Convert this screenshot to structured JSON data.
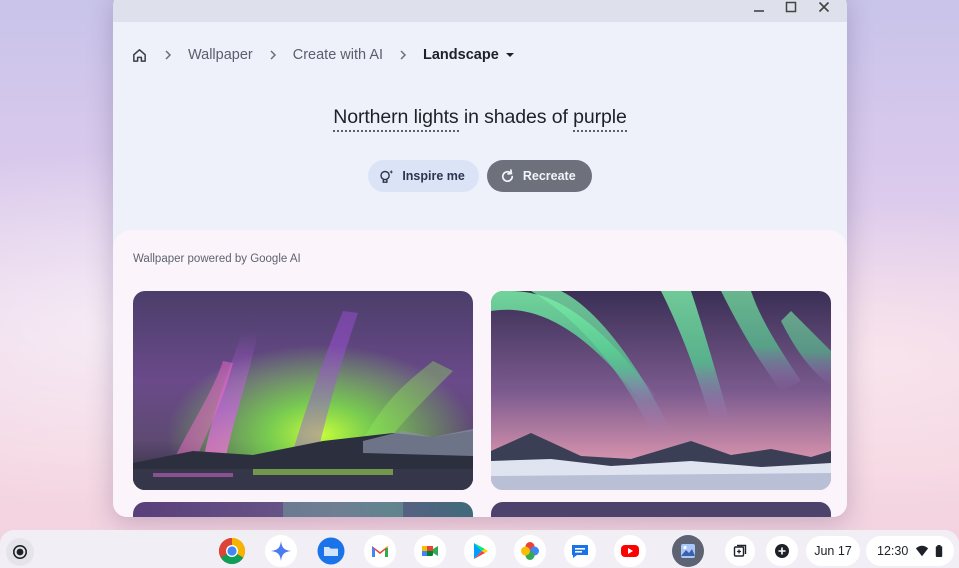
{
  "breadcrumb": {
    "items": [
      "Wallpaper",
      "Create with AI"
    ],
    "current": "Landscape"
  },
  "prompt": {
    "subject": "Northern lights",
    "connector": " in shades of ",
    "color": "purple"
  },
  "buttons": {
    "inspire": "Inspire me",
    "recreate": "Recreate"
  },
  "gallery": {
    "label": "Wallpaper powered by Google AI"
  },
  "shelf": {
    "apps": [
      "chrome-icon",
      "gemini-icon",
      "files-icon",
      "gmail-icon",
      "meet-icon",
      "play-store-icon",
      "photos-icon",
      "messages-icon",
      "youtube-icon",
      "wallpaper-app-icon"
    ],
    "date": "Jun 17",
    "time": "12:30"
  },
  "colors": {
    "recreate_bg": "#6c717b",
    "inspire_bg": "#dbe4f6",
    "window_bg": "#eef0fa"
  }
}
